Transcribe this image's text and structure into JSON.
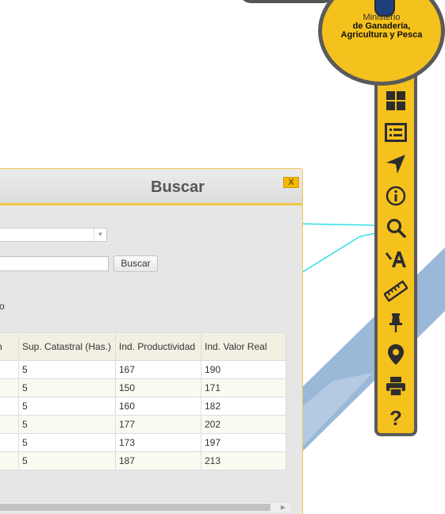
{
  "colors": {
    "toolbar_accent": "#f5c11c",
    "toolbar_border": "#5a5a5a",
    "dialog_border": "#f1c645",
    "map_overlay": "#8fb0d4",
    "map_line": "#38e0e6"
  },
  "logo": {
    "line1": "Ministerio",
    "line2": "de Ganadería,",
    "line3": "Agricultura y Pesca"
  },
  "toolbar": {
    "tools": [
      {
        "icon": "grid-icon"
      },
      {
        "icon": "list-icon"
      },
      {
        "icon": "navigate-arrow-icon"
      },
      {
        "icon": "info-icon"
      },
      {
        "icon": "search-icon"
      },
      {
        "icon": "text-annotation-icon"
      },
      {
        "icon": "ruler-icon"
      },
      {
        "icon": "pin-icon"
      },
      {
        "icon": "location-marker-icon"
      },
      {
        "icon": "print-icon"
      },
      {
        "icon": "help-icon",
        "label": "?"
      }
    ]
  },
  "dialog": {
    "title": "Buscar",
    "close_label": "X",
    "search_button": "Buscar",
    "fragment_label": "o",
    "table": {
      "headers": [
        "n",
        "Sup. Catastral (Has.)",
        "Ind. Productividad",
        "Ind. Valor Real"
      ],
      "rows": [
        [
          "",
          "5",
          "167",
          "190"
        ],
        [
          "",
          "5",
          "150",
          "171"
        ],
        [
          "",
          "5",
          "160",
          "182"
        ],
        [
          "",
          "5",
          "177",
          "202"
        ],
        [
          "",
          "5",
          "173",
          "197"
        ],
        [
          "",
          "5",
          "187",
          "213"
        ]
      ]
    }
  }
}
